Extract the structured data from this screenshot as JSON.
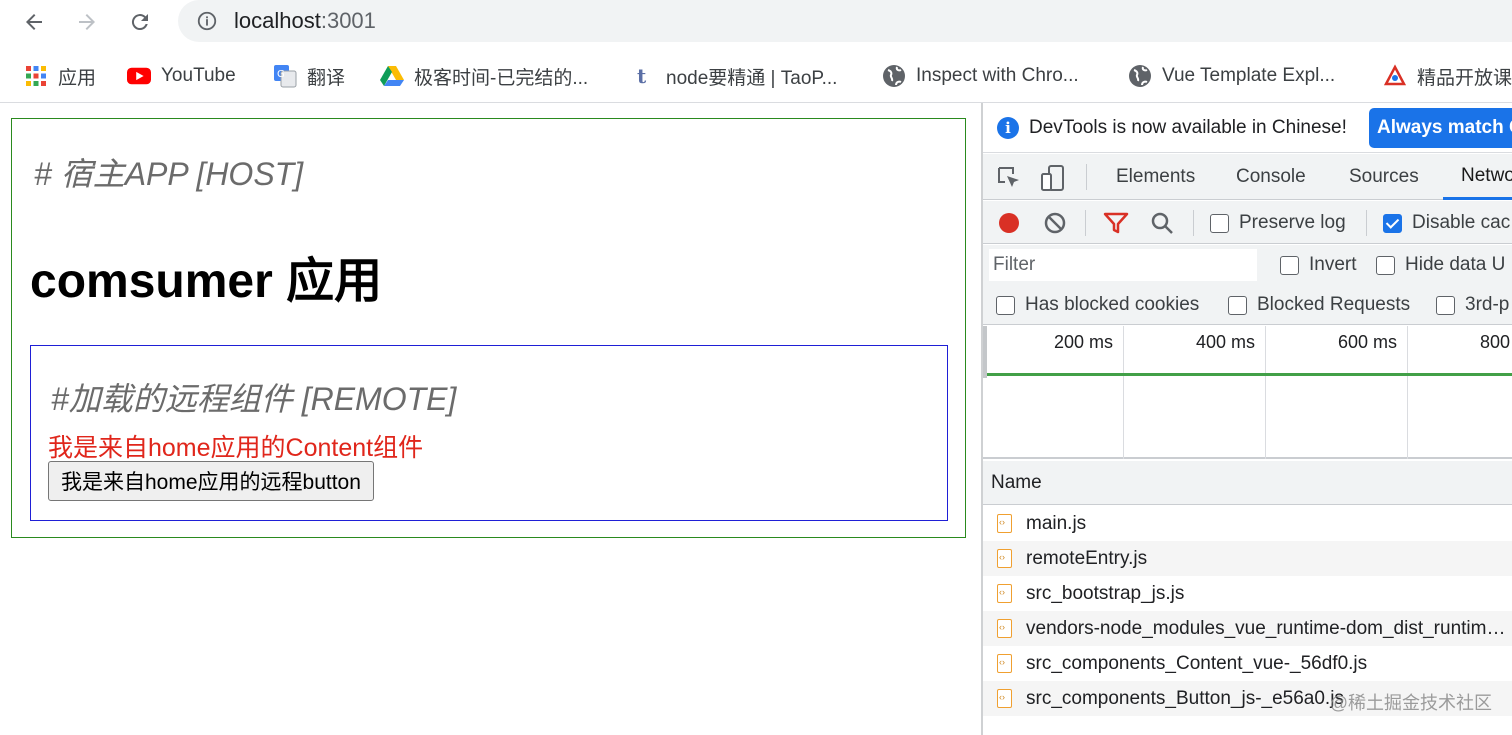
{
  "browser": {
    "url_host": "localhost",
    "url_port": ":3001",
    "bookmarks": [
      {
        "icon": "apps-grid-icon",
        "label": "应用"
      },
      {
        "icon": "youtube-icon",
        "label": "YouTube"
      },
      {
        "icon": "translate-icon",
        "label": "翻译"
      },
      {
        "icon": "google-drive-icon",
        "label": "极客时间-已完结的..."
      },
      {
        "icon": "taopu-icon",
        "label": "node要精通 | TaoP..."
      },
      {
        "icon": "globe-icon",
        "label": "Inspect with Chro..."
      },
      {
        "icon": "globe-icon",
        "label": "Vue Template Expl..."
      },
      {
        "icon": "jingpin-icon",
        "label": "精品开放课"
      }
    ]
  },
  "page": {
    "host_title": "# 宿主APP [HOST]",
    "host_heading": "comsumer 应用",
    "remote_title": "#加载的远程组件 [REMOTE]",
    "remote_content": "我是来自home应用的Content组件",
    "remote_button": "我是来自home应用的远程button"
  },
  "devtools": {
    "info_text": "DevTools is now available in Chinese!",
    "always_match": "Always match C",
    "tabs": [
      "Elements",
      "Console",
      "Sources",
      "Netwo"
    ],
    "active_tab": "Netwo",
    "preserve_log": "Preserve log",
    "disable_cache": "Disable cac",
    "filter_placeholder": "Filter",
    "invert": "Invert",
    "hide_data_urls": "Hide data U",
    "has_blocked_cookies": "Has blocked cookies",
    "blocked_requests": "Blocked Requests",
    "third_party": "3rd-p",
    "timeline_ticks": [
      "200 ms",
      "400 ms",
      "600 ms",
      "800"
    ],
    "name_header": "Name",
    "files": [
      "main.js",
      "remoteEntry.js",
      "src_bootstrap_js.js",
      "vendors-node_modules_vue_runtime-dom_dist_runtime-dom_esm-bundler_js.js",
      "src_components_Content_vue-_56df0.js",
      "src_components_Button_js-_e56a0.js"
    ]
  },
  "watermark": "@稀土掘金技术社区",
  "colors": {
    "accent": "#1a73e8",
    "host_border": "#2a8a1e",
    "remote_border": "#1f1fd6",
    "remote_text": "#e0261b",
    "record": "#d93025"
  }
}
